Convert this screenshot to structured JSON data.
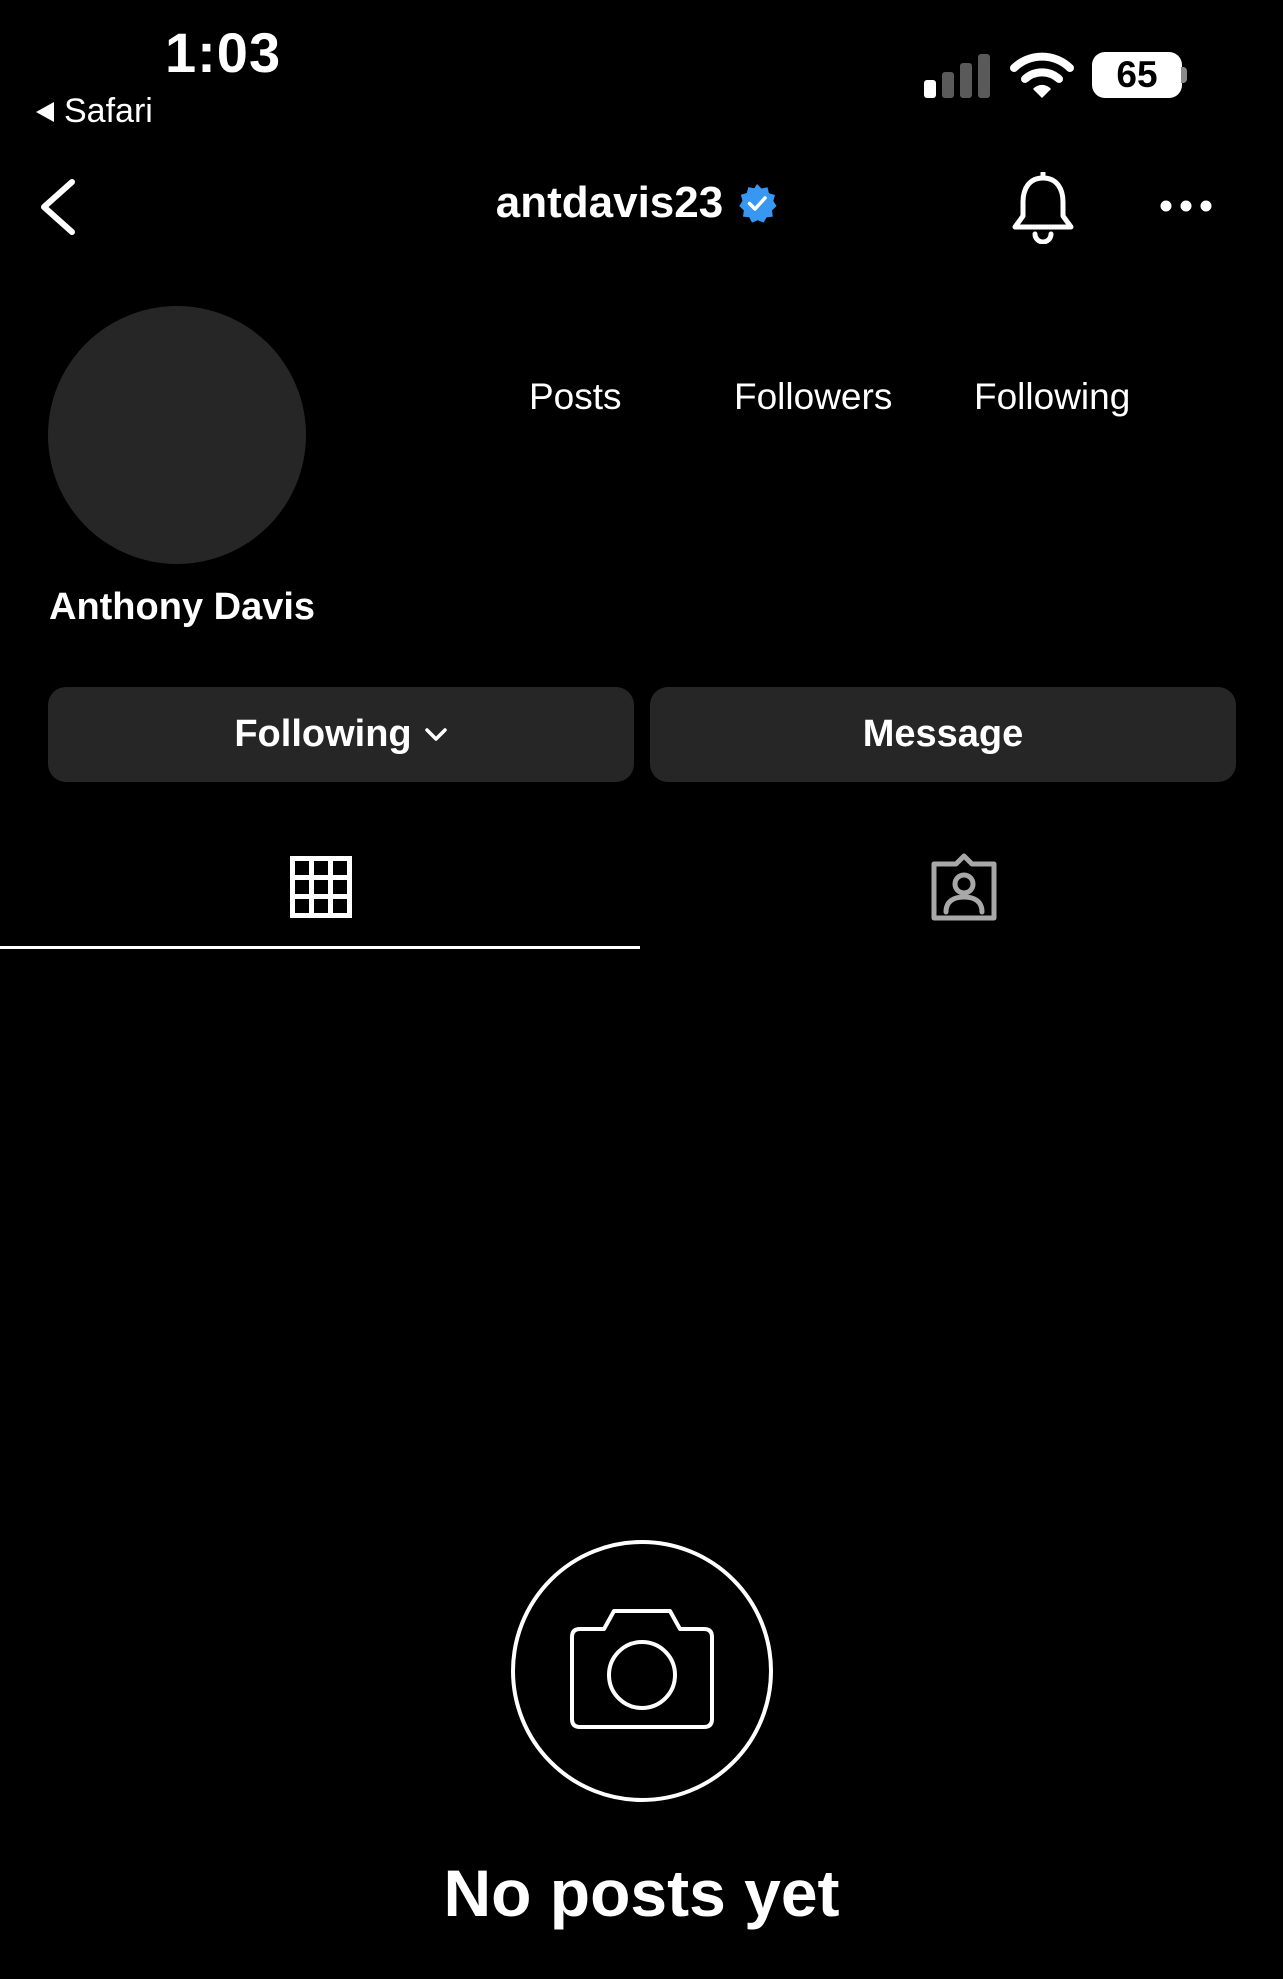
{
  "status_bar": {
    "time": "1:03",
    "back_app": "Safari",
    "battery": "65"
  },
  "nav": {
    "username": "antdavis23",
    "verified": true,
    "icons": [
      "chevron-left-icon",
      "verified-badge-icon",
      "bell-icon",
      "more-icon"
    ]
  },
  "profile": {
    "full_name": "Anthony Davis",
    "stats": {
      "posts_label": "Posts",
      "followers_label": "Followers",
      "following_label": "Following"
    }
  },
  "actions": {
    "following_label": "Following",
    "message_label": "Message"
  },
  "tabs": [
    {
      "name": "posts-grid",
      "icon": "grid-icon",
      "active": true
    },
    {
      "name": "tagged",
      "icon": "tagged-person-icon",
      "active": false
    }
  ],
  "empty_state": {
    "icon": "camera-icon",
    "title": "No posts yet"
  },
  "colors": {
    "background": "#000000",
    "surface": "#262626",
    "text": "#ffffff",
    "verified": "#3897f0"
  }
}
